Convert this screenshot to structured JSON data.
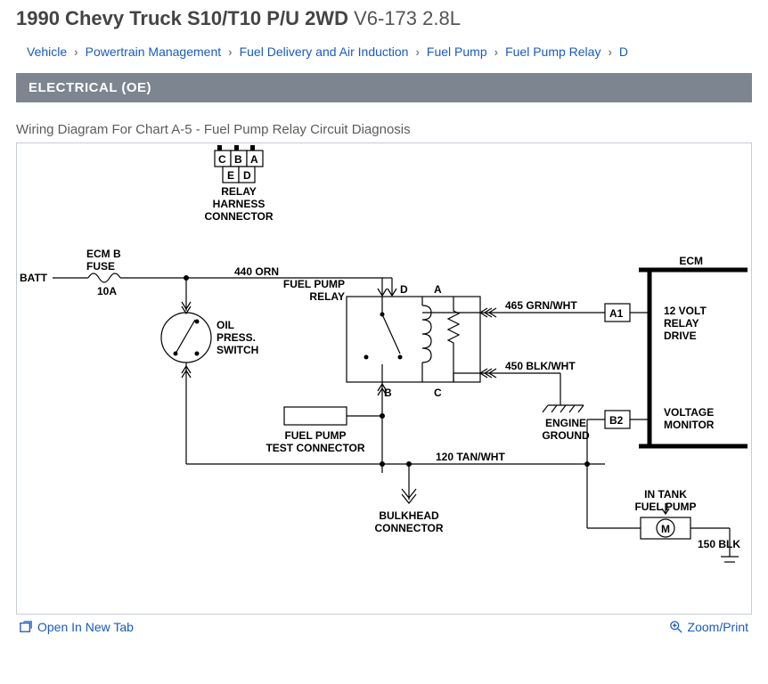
{
  "title": {
    "bold": "1990 Chevy Truck S10/T10 P/U 2WD",
    "rest": " V6-173 2.8L"
  },
  "breadcrumb": [
    "Vehicle",
    "Powertrain Management",
    "Fuel Delivery and Air Induction",
    "Fuel Pump",
    "Fuel Pump Relay",
    "D"
  ],
  "section": "ELECTRICAL (OE)",
  "figure_title": "Wiring Diagram For Chart A-5 - Fuel Pump Relay Circuit Diagnosis",
  "labels": {
    "batt": "BATT",
    "ecm_b_fuse": "ECM B",
    "fuse": "FUSE",
    "ten_a": "10A",
    "orn": "440 ORN",
    "relay_harness": "RELAY",
    "harness2": "HARNESS",
    "connector": "CONNECTOR",
    "fuel_pump_relay1": "FUEL PUMP",
    "fuel_pump_relay2": "RELAY",
    "oil1": "OIL",
    "oil2": "PRESS.",
    "oil3": "SWITCH",
    "fuel_pump_test1": "FUEL PUMP",
    "fuel_pump_test2": "TEST CONNECTOR",
    "grnwht": "465 GRN/WHT",
    "blkwht": "450 BLK/WHT",
    "tanwht": "120 TAN/WHT",
    "bulkhead1": "BULKHEAD",
    "bulkhead2": "CONNECTOR",
    "engine1": "ENGINE",
    "engine2": "GROUND",
    "ecm": "ECM",
    "relay_drive1": "12 VOLT",
    "relay_drive2": "RELAY",
    "relay_drive3": "DRIVE",
    "volt_mon1": "VOLTAGE",
    "volt_mon2": "MONITOR",
    "in_tank1": "IN TANK",
    "in_tank2": "FUEL PUMP",
    "blk150": "150 BLK",
    "pinA": "A",
    "pinB": "B",
    "pinC": "C",
    "pinD": "D",
    "pinE": "E",
    "A1": "A1",
    "B2": "B2",
    "M": "M"
  },
  "footer": {
    "open": "Open In New Tab",
    "zoom": "Zoom/Print"
  }
}
